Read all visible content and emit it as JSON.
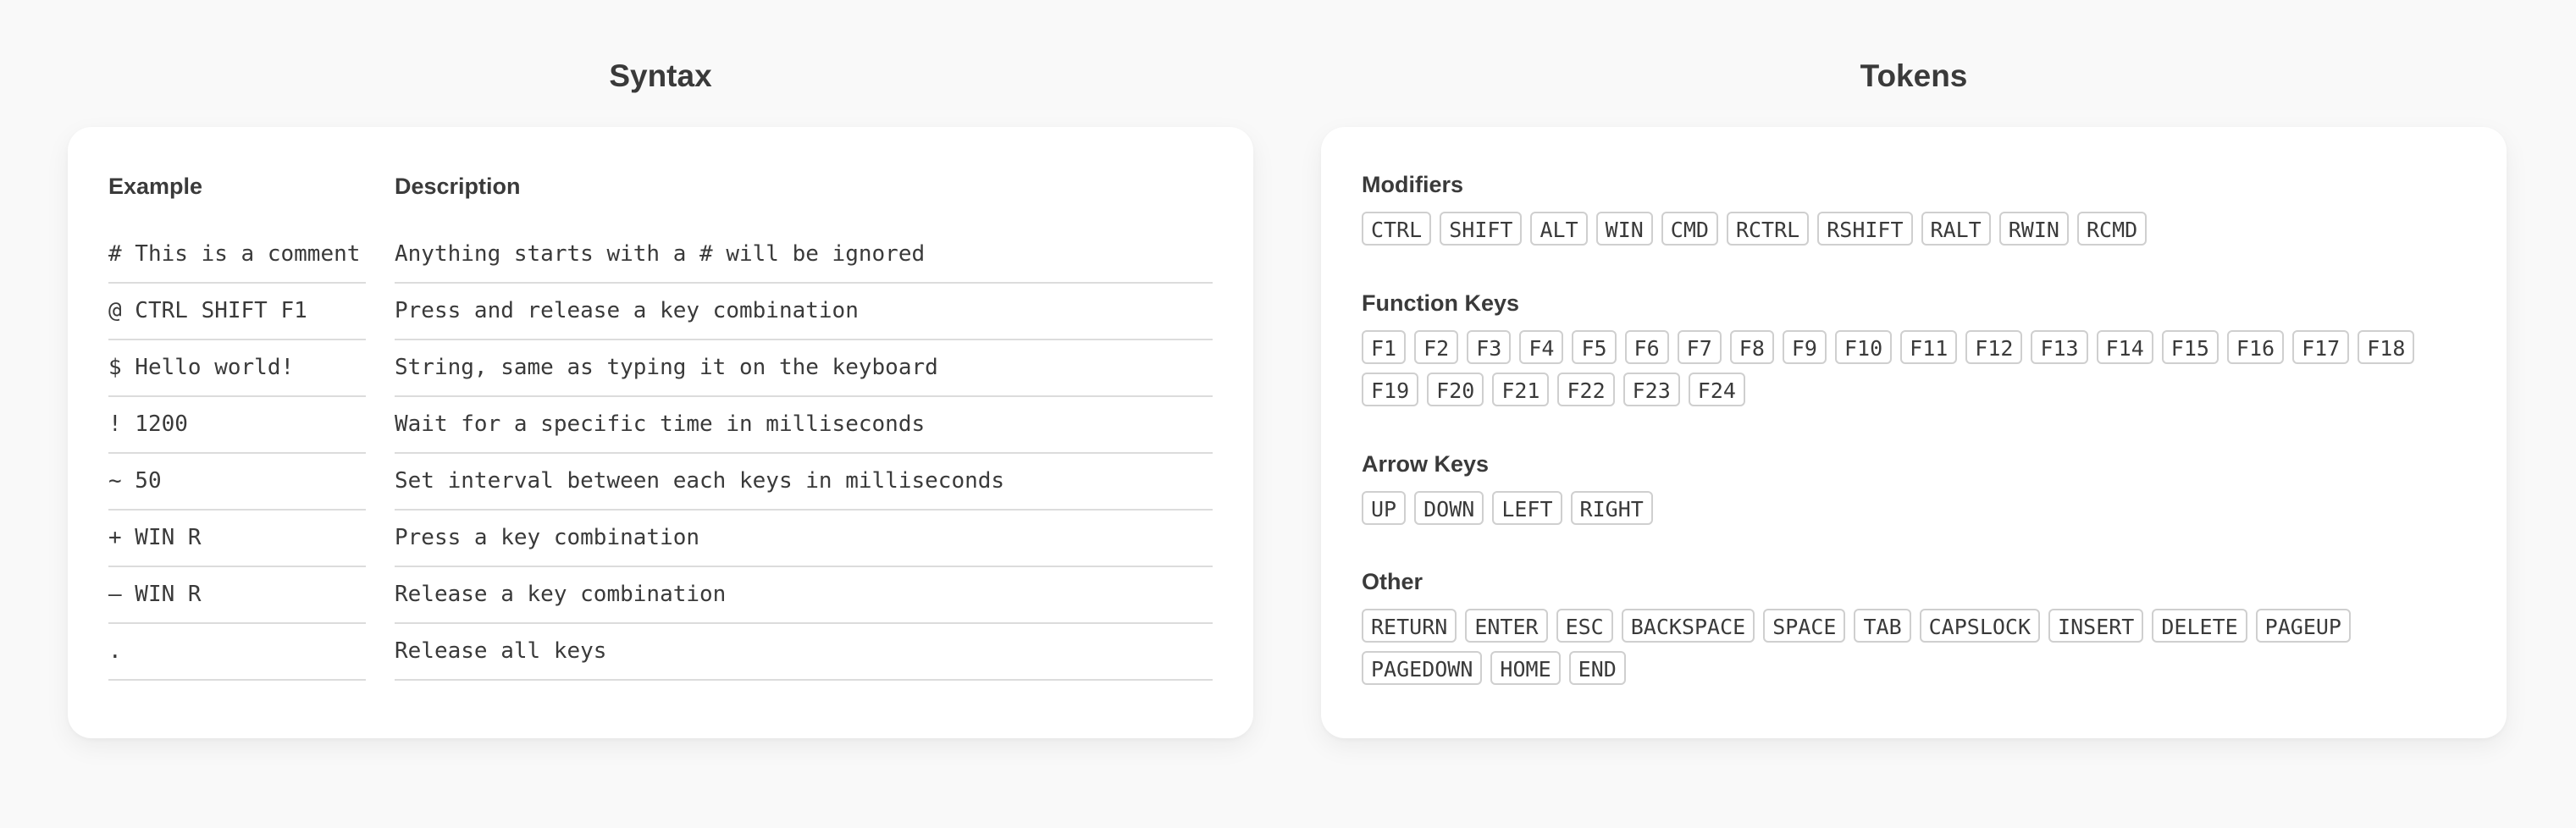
{
  "syntax": {
    "title": "Syntax",
    "headers": {
      "example": "Example",
      "description": "Description"
    },
    "rows": [
      {
        "example": "# This is a comment",
        "description": "Anything starts with a # will be ignored"
      },
      {
        "example": "@ CTRL SHIFT F1",
        "description": "Press and release a key combination"
      },
      {
        "example": "$ Hello world!",
        "description": "String, same as typing it on the keyboard"
      },
      {
        "example": "! 1200",
        "description": "Wait for a specific time in milliseconds"
      },
      {
        "example": "~ 50",
        "description": "Set interval between each keys in milliseconds"
      },
      {
        "example": "+ WIN R",
        "description": "Press a key combination"
      },
      {
        "example": "– WIN R",
        "description": "Release a key combination"
      },
      {
        "example": ".",
        "description": "Release all keys"
      }
    ]
  },
  "tokens": {
    "title": "Tokens",
    "groups": [
      {
        "title": "Modifiers",
        "items": [
          "CTRL",
          "SHIFT",
          "ALT",
          "WIN",
          "CMD",
          "RCTRL",
          "RSHIFT",
          "RALT",
          "RWIN",
          "RCMD"
        ]
      },
      {
        "title": "Function Keys",
        "items": [
          "F1",
          "F2",
          "F3",
          "F4",
          "F5",
          "F6",
          "F7",
          "F8",
          "F9",
          "F10",
          "F11",
          "F12",
          "F13",
          "F14",
          "F15",
          "F16",
          "F17",
          "F18",
          "F19",
          "F20",
          "F21",
          "F22",
          "F23",
          "F24"
        ]
      },
      {
        "title": "Arrow Keys",
        "items": [
          "UP",
          "DOWN",
          "LEFT",
          "RIGHT"
        ]
      },
      {
        "title": "Other",
        "items": [
          "RETURN",
          "ENTER",
          "ESC",
          "BACKSPACE",
          "SPACE",
          "TAB",
          "CAPSLOCK",
          "INSERT",
          "DELETE",
          "PAGEUP",
          "PAGEDOWN",
          "HOME",
          "END"
        ]
      }
    ]
  }
}
